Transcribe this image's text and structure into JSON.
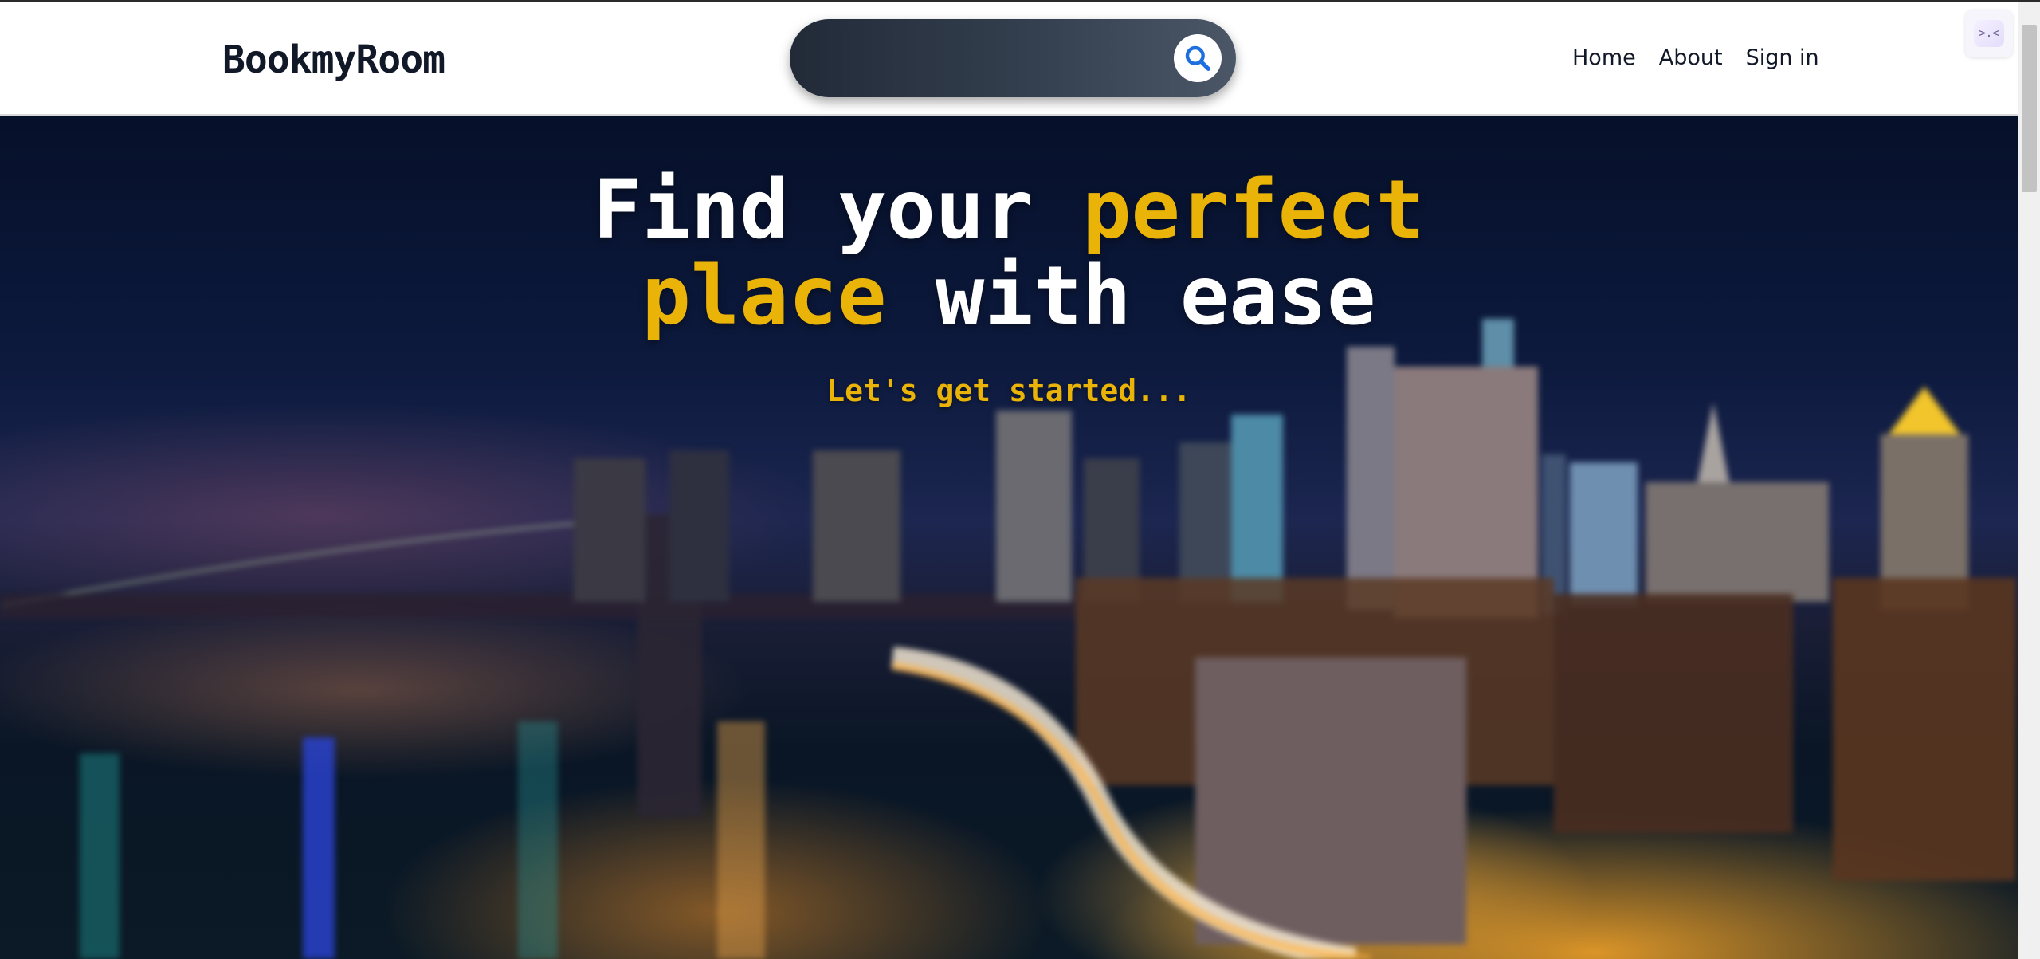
{
  "header": {
    "logo": "BookmyRoom",
    "search": {
      "value": "",
      "placeholder": ""
    },
    "nav": [
      {
        "label": "Home"
      },
      {
        "label": "About"
      },
      {
        "label": "Sign in"
      }
    ],
    "extension_icon_glyph": ">.<"
  },
  "hero": {
    "title_line1_part1": "Find your ",
    "title_line1_accent": "perfect",
    "title_line2_accent": "place",
    "title_line2_part2": " with ease",
    "subtitle": "Let's get started...",
    "background": "night-city-skyline-image"
  },
  "colors": {
    "accent": "#eab308",
    "navy": "#111827",
    "search_bg": "#2b3544"
  },
  "icons": {
    "search": "search-icon",
    "extension": "extension-icon"
  }
}
